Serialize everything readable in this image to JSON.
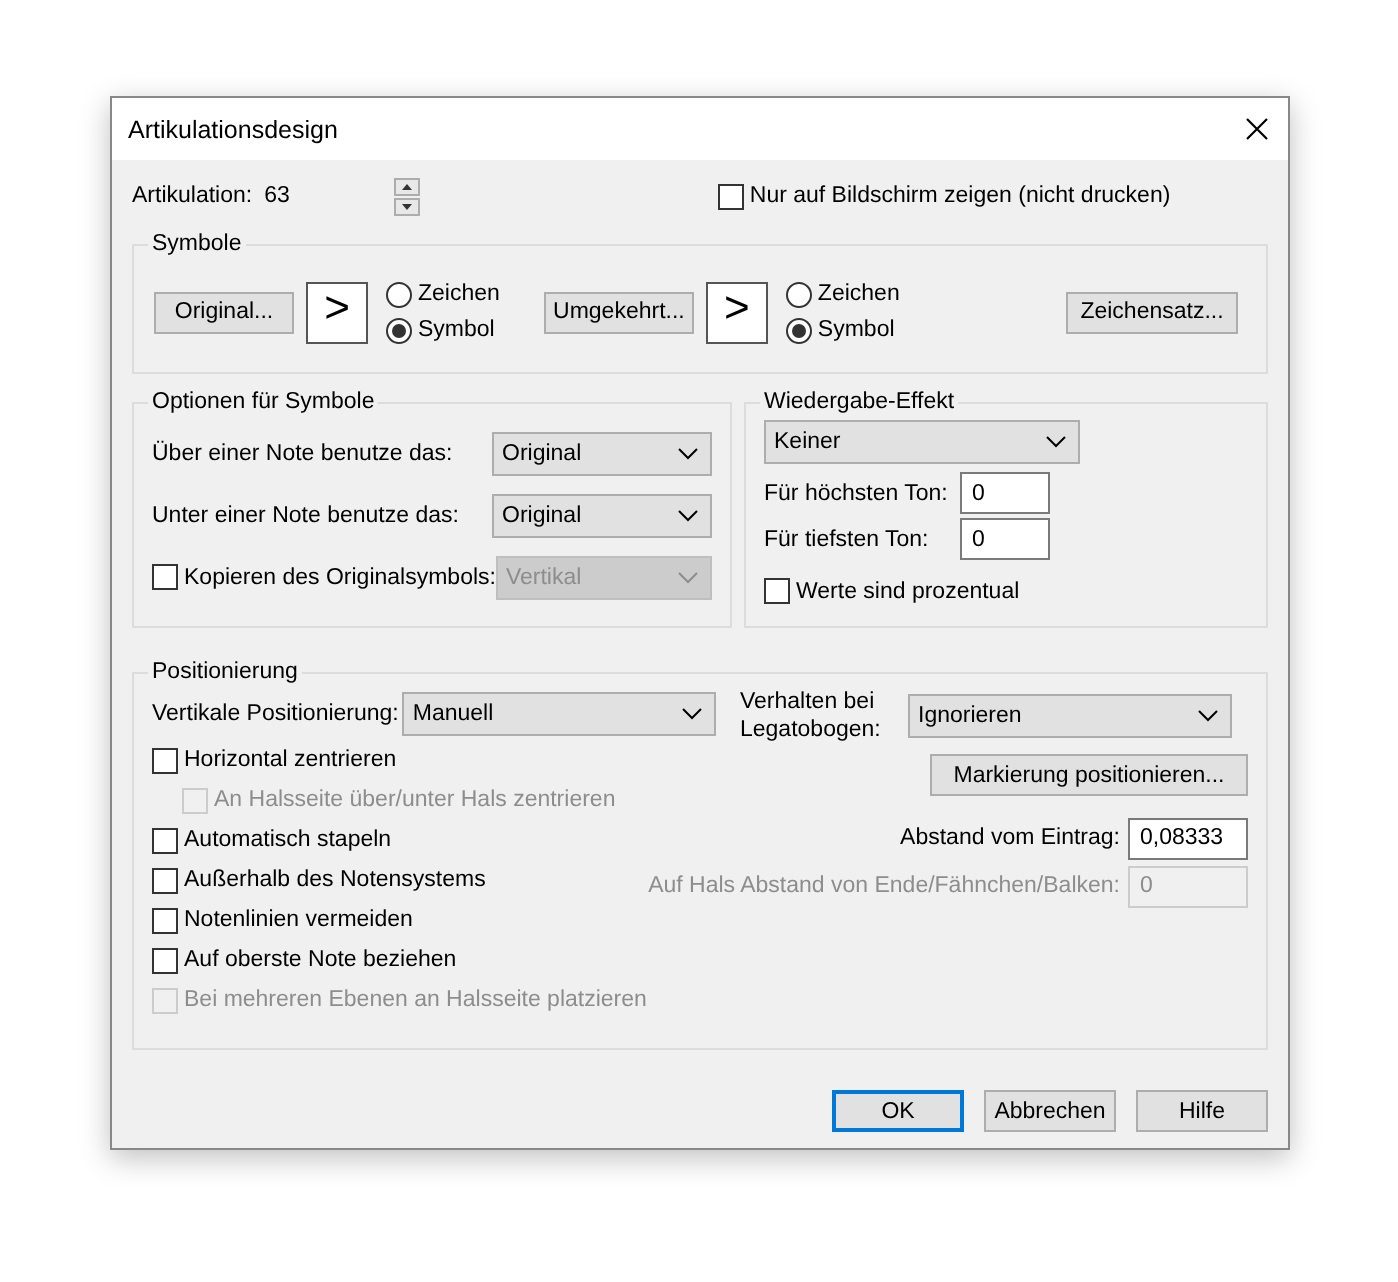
{
  "window": {
    "title": "Artikulationsdesign"
  },
  "articulation": {
    "label": "Artikulation:",
    "value": "63"
  },
  "screen_only": {
    "label": "Nur auf Bildschirm zeigen (nicht drucken)",
    "checked": false
  },
  "symbols": {
    "title": "Symbole",
    "sets": [
      {
        "button": "Original...",
        "preview": ">",
        "options": [
          {
            "label": "Zeichen",
            "selected": false
          },
          {
            "label": "Symbol",
            "selected": true
          }
        ]
      },
      {
        "button": "Umgekehrt...",
        "preview": ">",
        "options": [
          {
            "label": "Zeichen",
            "selected": false
          },
          {
            "label": "Symbol",
            "selected": true
          }
        ]
      }
    ],
    "font_button": "Zeichensatz..."
  },
  "symbol_options": {
    "title": "Optionen für Symbole",
    "rows": [
      {
        "kind": "select",
        "label": "Über einer Note benutze das:",
        "value": "Original",
        "disabled": false
      },
      {
        "kind": "select",
        "label": "Unter einer Note benutze das:",
        "value": "Original",
        "disabled": false
      },
      {
        "kind": "checkbox",
        "label": "Kopieren des Originalsymbols:",
        "checked": false,
        "value": "Vertikal",
        "disabled": true
      }
    ]
  },
  "playback": {
    "title": "Wiedergabe-Effekt",
    "effect": "Keiner",
    "fields": [
      {
        "label": "Für höchsten Ton:",
        "value": "0"
      },
      {
        "label": "Für tiefsten Ton:",
        "value": "0"
      }
    ],
    "percent": {
      "label": "Werte sind prozentual",
      "checked": false
    }
  },
  "positioning": {
    "title": "Positionierung",
    "vertical": {
      "label": "Vertikale Positionierung:",
      "value": "Manuell"
    },
    "options": [
      {
        "label": "Horizontal zentrieren",
        "checked": false,
        "disabled": false,
        "children": [
          {
            "label": "An Halsseite über/unter Hals zentrieren",
            "checked": false,
            "disabled": true
          }
        ]
      },
      {
        "label": "Automatisch stapeln",
        "checked": false,
        "disabled": false
      },
      {
        "label": "Außerhalb des Notensystems",
        "checked": false,
        "disabled": false
      },
      {
        "label": "Notenlinien vermeiden",
        "checked": false,
        "disabled": false
      },
      {
        "label": "Auf oberste Note beziehen",
        "checked": false,
        "disabled": false
      },
      {
        "label": "Bei mehreren Ebenen an Halsseite platzieren",
        "checked": false,
        "disabled": true
      }
    ],
    "legato": {
      "label": "Verhalten bei Legatobogen:",
      "value": "Ignorieren"
    },
    "mark_button": "Markierung positionieren...",
    "fields": [
      {
        "label": "Abstand vom Eintrag:",
        "value": "0,08333",
        "disabled": false
      },
      {
        "label": "Auf Hals Abstand von Ende/Fähnchen/Balken:",
        "value": "0",
        "disabled": true
      }
    ]
  },
  "buttons": [
    {
      "label": "OK",
      "default": true
    },
    {
      "label": "Abbrechen",
      "default": false
    },
    {
      "label": "Hilfe",
      "default": false
    }
  ]
}
